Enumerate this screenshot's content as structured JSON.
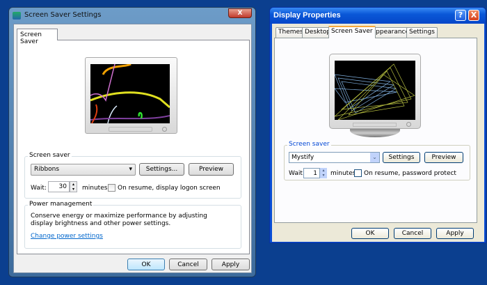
{
  "win7": {
    "title": "Screen Saver Settings",
    "tab": "Screen Saver",
    "close_label": "X",
    "screen_saver_group": "Screen saver",
    "screen_saver_value": "Ribbons",
    "settings_label": "Settings...",
    "preview_label": "Preview",
    "wait_label": "Wait:",
    "wait_value": "30",
    "minutes_label": "minutes",
    "resume_label": "On resume, display logon screen",
    "resume_checked": false,
    "power_group": "Power management",
    "power_text": "Conserve energy or maximize performance by adjusting display brightness and other power settings.",
    "power_link": "Change power settings",
    "ok": "OK",
    "cancel": "Cancel",
    "apply": "Apply"
  },
  "xp": {
    "title": "Display Properties",
    "help_label": "?",
    "close_label": "X",
    "tabs": [
      {
        "label": "Themes"
      },
      {
        "label": "Desktop"
      },
      {
        "label": "Screen Saver",
        "active": true
      },
      {
        "label": "Appearance"
      },
      {
        "label": "Settings"
      }
    ],
    "screen_saver_group": "Screen saver",
    "screen_saver_value": "Mystify",
    "settings_label": "Settings",
    "preview_label": "Preview",
    "wait_label": "Wait:",
    "wait_value": "1",
    "minutes_label": "minutes",
    "resume_label": "On resume, password protect",
    "resume_checked": false,
    "ok": "OK",
    "cancel": "Cancel",
    "apply": "Apply"
  },
  "colors": {
    "desktop": "#0b3f8f",
    "link": "#0066cc",
    "xp_title": "#0a58d8"
  }
}
